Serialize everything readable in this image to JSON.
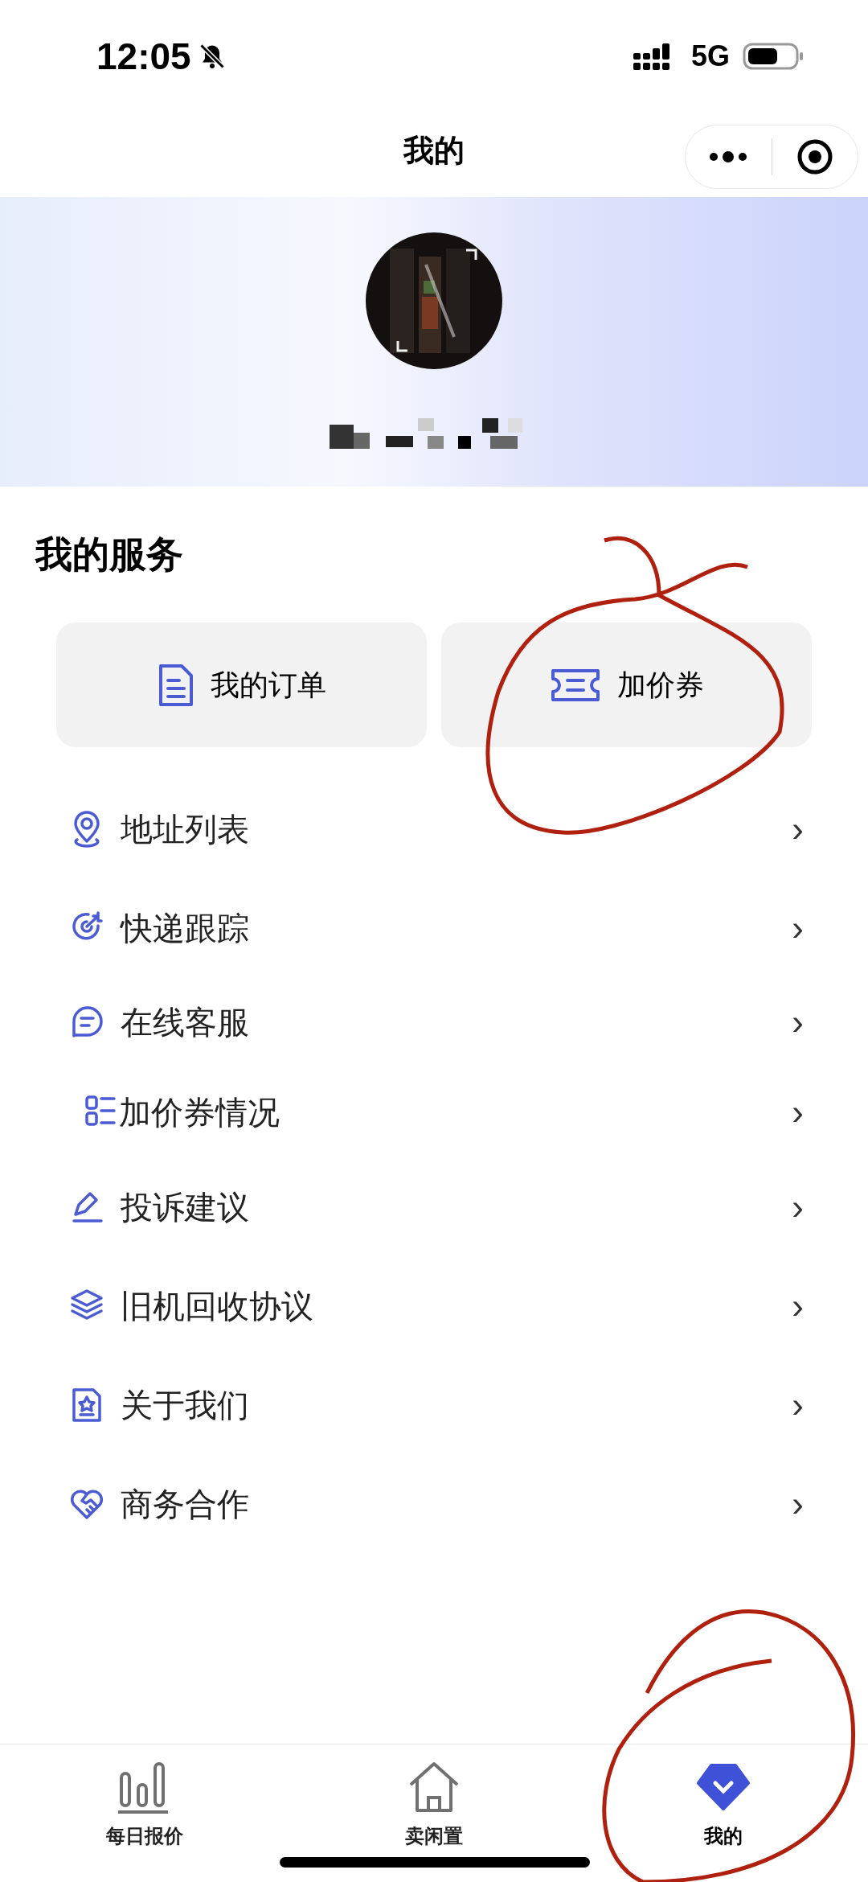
{
  "status_bar": {
    "time": "12:05",
    "network": "5G"
  },
  "nav_bar": {
    "title": "我的"
  },
  "services": {
    "title": "我的服务",
    "cards": [
      {
        "label": "我的订单"
      },
      {
        "label": "加价券"
      }
    ]
  },
  "menu": [
    {
      "label": "地址列表",
      "arrow": "›"
    },
    {
      "label": "快递跟踪",
      "arrow": "›"
    },
    {
      "label": "在线客服",
      "arrow": "›"
    },
    {
      "label": "加价券情况",
      "arrow": "›"
    },
    {
      "label": "投诉建议",
      "arrow": "›"
    },
    {
      "label": "旧机回收协议",
      "arrow": "›"
    },
    {
      "label": "关于我们",
      "arrow": "›"
    },
    {
      "label": "商务合作",
      "arrow": "›"
    }
  ],
  "tab_bar": [
    {
      "label": "每日报价",
      "selected": false
    },
    {
      "label": "卖闲置",
      "selected": false
    },
    {
      "label": "我的",
      "selected": true
    }
  ]
}
